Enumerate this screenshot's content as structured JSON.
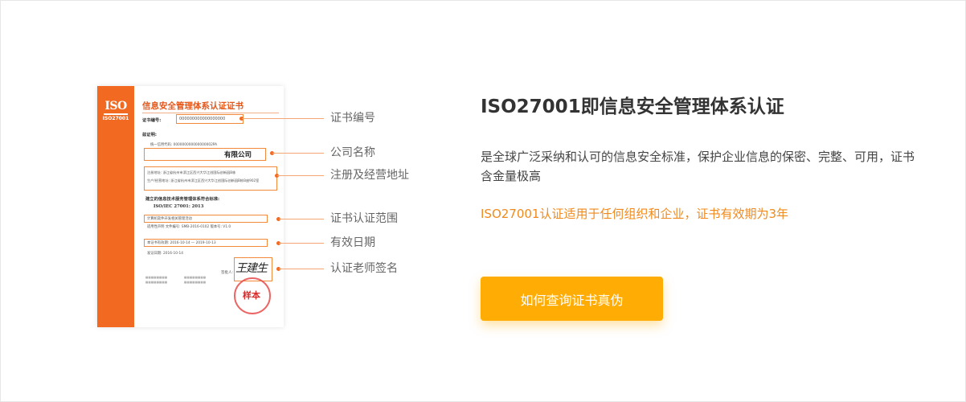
{
  "certificate": {
    "logo": {
      "big": "ISO",
      "small": "ISO27001"
    },
    "title": "信息安全管理体系认证证书",
    "number_label": "证书编号:",
    "number_value": "000000000000000000",
    "certify_label": "兹证明:",
    "credit_code": "统一信用代码: 000000000000000002PA",
    "company_name": "有限公司",
    "reg_address": "注册地址: 浙江省杭州市滨江区西兴大华江创国际创新园B栋",
    "prod_address": "生产/经营地址: 浙江省杭州市滨江区西兴大华江创国际创新园B栋B座902室",
    "standard_label": "建立的信息技术服务管理体系符合标准:",
    "standard_value": "ISO/IEC 27001: 2013",
    "scope_value": "计算机软件开发相关管理活动",
    "applicability": "适用性声明 文件编号: SMB-2016-0102 版本号: V1.0",
    "valid_range": "本证书有效期: 2016-10-14 — 2019-10-13",
    "issue_date": "发证日期: 2016-10-14",
    "signatory": "签批人:",
    "seal_text": "样本",
    "signature": "王建生"
  },
  "callouts": [
    "证书编号",
    "公司名称",
    "注册及经营地址",
    "证书认证范围",
    "有效日期",
    "认证老师签名"
  ],
  "content": {
    "title": "ISO27001即信息安全管理体系认证",
    "description": "是全球广泛采纳和认可的信息安全标准，保护企业信息的保密、完整、可用，证书含金量极高",
    "highlight": "ISO27001认证适用于任何组织和企业，证书有效期为3年",
    "button_label": "如何查询证书真伪"
  },
  "colors": {
    "brand_orange": "#f26a21",
    "accent_text": "#f08a1e",
    "button": "#ffac04"
  }
}
